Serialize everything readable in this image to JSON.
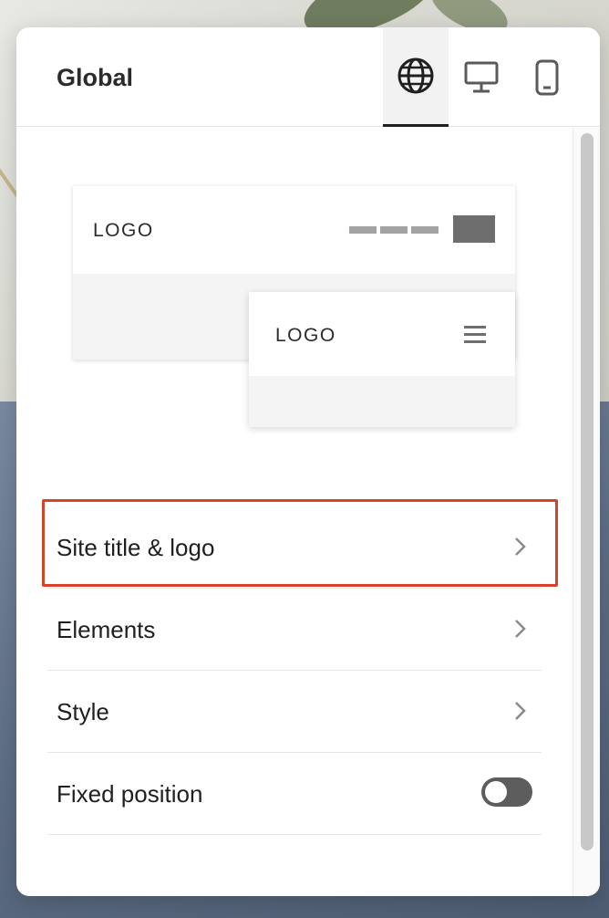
{
  "panel": {
    "title": "Global",
    "tabs": [
      {
        "icon": "globe-icon",
        "active": true
      },
      {
        "icon": "desktop-icon",
        "active": false
      },
      {
        "icon": "mobile-icon",
        "active": false
      }
    ]
  },
  "preview": {
    "desktop_logo": "LOGO",
    "mobile_logo": "LOGO"
  },
  "menu": {
    "items": [
      {
        "label": "Site title & logo"
      },
      {
        "label": "Elements"
      },
      {
        "label": "Style"
      },
      {
        "label": "Fixed position"
      }
    ]
  },
  "fixed_position": {
    "enabled": false
  },
  "colors": {
    "highlight": "#d4432c",
    "toggle_off": "#5d5d5d"
  }
}
